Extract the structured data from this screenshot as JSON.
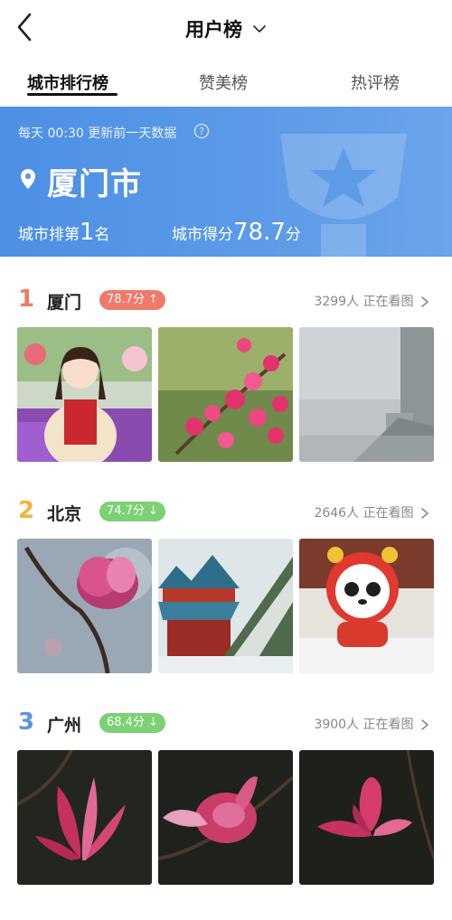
{
  "header": {
    "title": "用户榜"
  },
  "tabs": [
    {
      "label": "城市排行榜"
    },
    {
      "label": "赞美榜"
    },
    {
      "label": "热评榜"
    }
  ],
  "banner": {
    "update_note": "每天 00:30 更新前一天数据",
    "city": "厦门市",
    "rank_prefix": "城市排第",
    "rank_value": "1",
    "rank_suffix": "名",
    "score_prefix": "城市得分",
    "score_value": "78.7",
    "score_suffix": "分"
  },
  "rankings": [
    {
      "rank": "1",
      "city": "厦门",
      "score": "78.7分 ↑",
      "watching": "3299人 正在看图",
      "rank_color": "#f07b62",
      "pill_color": "#f07a6a"
    },
    {
      "rank": "2",
      "city": "北京",
      "score": "74.7分 ↓",
      "watching": "2646人 正在看图",
      "rank_color": "#f4b43a",
      "pill_color": "#7bd174"
    },
    {
      "rank": "3",
      "city": "广州",
      "score": "68.4分 ↓",
      "watching": "3900人 正在看图",
      "rank_color": "#5b95e0",
      "pill_color": "#7bd174"
    }
  ]
}
